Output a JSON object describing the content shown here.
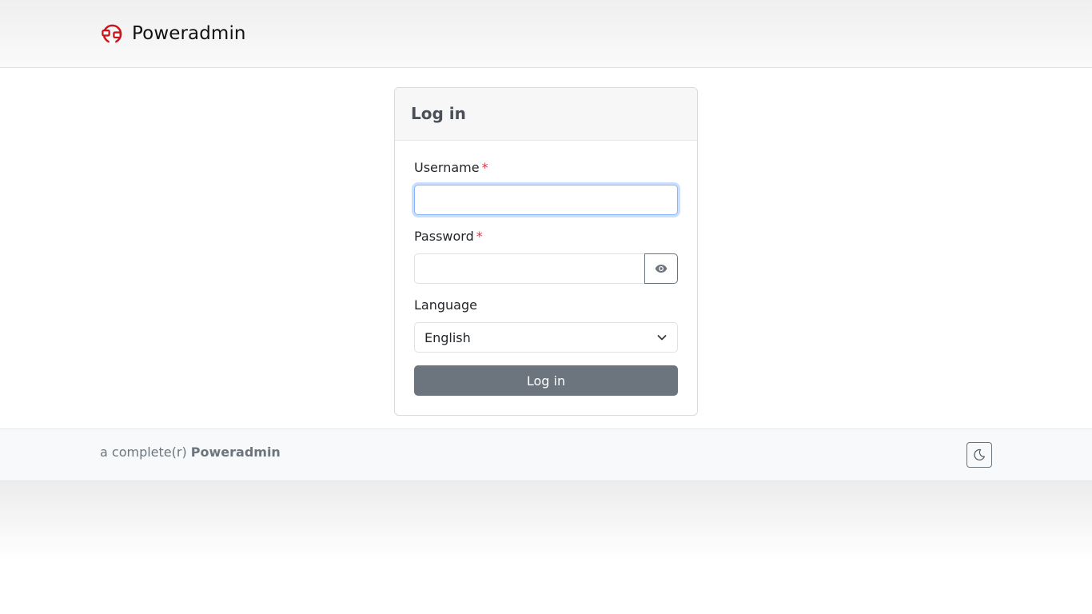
{
  "brand": {
    "name": "Poweradmin",
    "logo_icon": "poweradmin-logo-icon",
    "logo_color": "#c8161d"
  },
  "login": {
    "title": "Log in",
    "username_label": "Username",
    "username_value": "",
    "password_label": "Password",
    "password_value": "",
    "required_marker": "*",
    "show_password_icon": "eye-icon",
    "language_label": "Language",
    "language_selected": "English",
    "submit_label": "Log in"
  },
  "footer": {
    "prefix": "a complete(r)",
    "product": "Poweradmin",
    "theme_toggle_icon": "moon-icon"
  },
  "colors": {
    "required": "#dc3545",
    "button": "#6c757d",
    "focus": "#86b7fe"
  }
}
